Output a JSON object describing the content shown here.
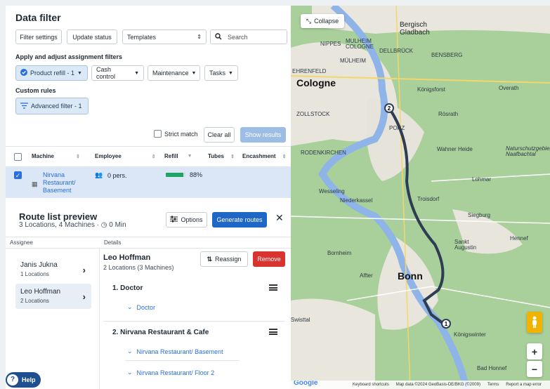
{
  "filter": {
    "title": "Data filter",
    "filter_settings": "Filter settings",
    "update_status": "Update status",
    "templates": "Templates",
    "search_placeholder": "Search",
    "apply_label": "Apply and adjust assignment filters",
    "chips": [
      "Product refill - 1",
      "Cash control",
      "Maintenance",
      "Tasks"
    ],
    "custom_rules": "Custom rules",
    "advanced_filter": "Advanced filter - 1",
    "strict_match": "Strict match",
    "clear_all": "Clear all",
    "show_results": "Show results"
  },
  "table": {
    "columns": [
      "Machine",
      "Employee",
      "Refill",
      "Tubes",
      "Encashment"
    ],
    "rows": [
      {
        "machine": "Nirvana Restaurant/ Basement",
        "employee": "0 pers.",
        "refill": "88%",
        "refill_fraction": 0.88
      }
    ]
  },
  "route": {
    "title": "Route list preview",
    "subtitle": "3 Locations, 4 Machines",
    "duration": "0 Min",
    "options": "Options",
    "generate": "Generate routes",
    "assignee_header": "Assignee",
    "details_header": "Details",
    "assignees": [
      {
        "name": "Janis Jukna",
        "sub": "1 Locations"
      },
      {
        "name": "Leo Hoffman",
        "sub": "2 Locations"
      }
    ],
    "selected": {
      "name": "Leo Hoffman",
      "sub": "2 Locations (3 Machines)",
      "reassign": "Reassign",
      "remove": "Remove",
      "stops": [
        {
          "title": "1.  Doctor",
          "machines": [
            "Doctor"
          ]
        },
        {
          "title": "2.  Nirvana Restaurant & Cafe",
          "machines": [
            "Nirvana Restaurant/ Basement",
            "Nirvana Restaurant/ Floor 2"
          ]
        }
      ]
    },
    "help": "Help"
  },
  "map": {
    "collapse": "Collapse",
    "labels": {
      "bergisch": "Bergisch\nGladbach",
      "cologne": "Cologne",
      "bonn": "Bonn",
      "nippes": "NIPPES",
      "mulheim": "MÜLHEIM",
      "koln": "MULHEIM\nCOLOGNE",
      "dellbruck": "DELLBRÜCK",
      "bensberg": "BENSBERG",
      "ehrenfeld": "EHRENFELD",
      "overath": "Overath",
      "koenigsforst": "Königsforst",
      "porz": "PORZ",
      "rosrath": "Rösrath",
      "zollstock": "ZOLLSTOCK",
      "rodenkirchen": "RODENKIRCHEN",
      "wahner": "Wahner Heide",
      "lohmar": "Lohmar",
      "wesseling": "Wesseling",
      "niederkassel": "Niederkassel",
      "troisdorf": "Troisdorf",
      "siegburg": "Siegburg",
      "hennef": "Hennef",
      "sankt": "Sankt\nAugustin",
      "bornheim": "Bornheim",
      "alfter": "Alfter",
      "konigswinter": "Königswinter",
      "badhonnef": "Bad Honnef",
      "swisttal": "Swisttal",
      "natur": "Naturschutzgebiet\nNaafbachtal"
    },
    "attribution": [
      "Keyboard shortcuts",
      "Map data ©2024 GeoBasis-DE/BKG (©2009)",
      "Terms",
      "Report a map error"
    ],
    "google": "Google",
    "stop_numbers": [
      "1",
      "2"
    ],
    "route_color": "#2e3d52"
  }
}
